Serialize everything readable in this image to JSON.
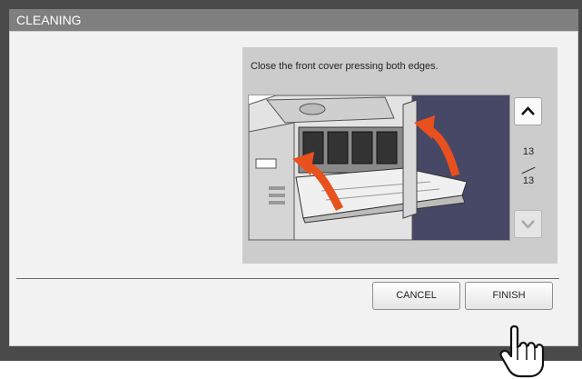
{
  "window": {
    "title": "CLEANING"
  },
  "guide": {
    "instruction": "Close the front cover pressing both edges.",
    "illustration": "front-cover-closing-illustration",
    "page_current": "13",
    "page_total": "13"
  },
  "buttons": {
    "cancel_label": "CANCEL",
    "finish_label": "FINISH"
  },
  "icons": {
    "up": "chevron-up-icon",
    "down": "chevron-down-icon",
    "cursor": "hand-pointer-icon"
  },
  "colors": {
    "title_bar": "#7f7f7f",
    "frame": "#4a4a4a",
    "panel": "#f2f2f2",
    "guide_box": "#cccccc",
    "arrow": "#e8501e",
    "illustration_bg": "#474766"
  }
}
